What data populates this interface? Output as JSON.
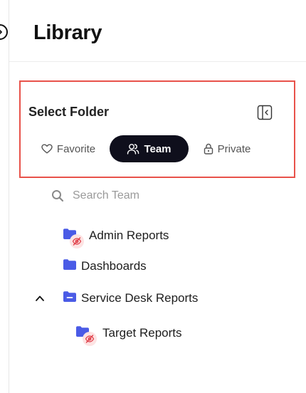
{
  "header": {
    "title": "Library"
  },
  "folder_selector": {
    "title": "Select Folder",
    "tabs": [
      {
        "label": "Favorite",
        "icon": "heart-icon",
        "active": false
      },
      {
        "label": "Team",
        "icon": "users-icon",
        "active": true
      },
      {
        "label": "Private",
        "icon": "lock-icon",
        "active": false
      }
    ]
  },
  "search": {
    "placeholder": "Search Team"
  },
  "tree": {
    "items": [
      {
        "label": "Admin Reports",
        "icon": "folder-hidden-icon"
      },
      {
        "label": "Dashboards",
        "icon": "folder-icon"
      },
      {
        "label": "Service Desk Reports",
        "icon": "folder-collapse-icon",
        "expanded": true
      },
      {
        "label": "Target Reports",
        "icon": "folder-hidden-icon"
      }
    ]
  },
  "colors": {
    "accent": "#4a5be6",
    "active_tab_bg": "#0f0f1c",
    "highlight_border": "#e8524a",
    "hidden_badge_bg": "#fde3e3",
    "hidden_badge_icon": "#e0404a"
  }
}
